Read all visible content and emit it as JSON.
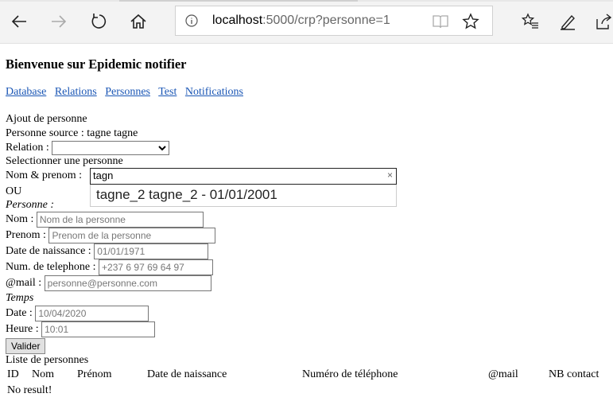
{
  "browser": {
    "url_host": "localhost",
    "url_rest": ":5000/crp?personne=1"
  },
  "page": {
    "title": "Bienvenue sur Epidemic notifier",
    "nav": [
      "Database",
      "Relations",
      "Personnes",
      "Test",
      "Notifications"
    ],
    "ajout_label": "Ajout de personne",
    "source_label": "Personne source : tagne tagne",
    "relation_label": "Relation :",
    "relation_value": "",
    "select_label": "Selectionner une personne",
    "nom_prenom_label": "Nom & prenom :",
    "search_value": "tagn",
    "search_clear": "×",
    "suggestion": "tagne_2 tagne_2 - 01/01/2001",
    "ou_label": "OU",
    "personne_heading": "Personne :",
    "nom_label": "Nom :",
    "nom_placeholder": "Nom de la personne",
    "prenom_label": "Prenom :",
    "prenom_placeholder": "Prenom de la personne",
    "dob_label": "Date de naissance :",
    "dob_placeholder": "01/01/1971",
    "tel_label": "Num. de telephone :",
    "tel_placeholder": "+237 6 97 69 64 97",
    "mail_label": "@mail :",
    "mail_placeholder": "personne@personne.com",
    "temps_heading": "Temps",
    "date_label": "Date :",
    "date_placeholder": "10/04/2020",
    "heure_label": "Heure :",
    "heure_placeholder": "10:01",
    "valider_label": "Valider",
    "liste_label": "Liste de personnes",
    "columns": [
      "ID",
      "Nom",
      "Prénom",
      "Date de naissance",
      "Numéro de téléphone",
      "@mail",
      "NB contact"
    ],
    "no_result": "No result!"
  }
}
